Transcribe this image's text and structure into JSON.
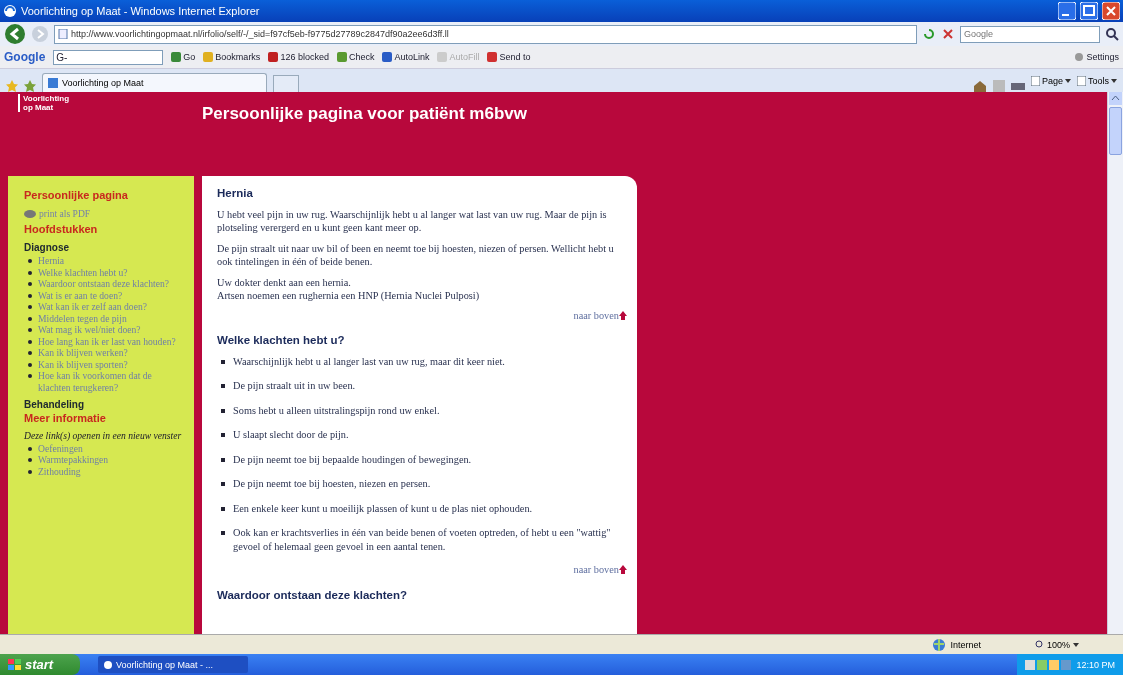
{
  "window": {
    "title": "Voorlichting op Maat - Windows Internet Explorer"
  },
  "address_bar": {
    "url": "http://www.voorlichtingopmaat.nl/irfolio/self/-/_sid=f97cf5eb-f9775d27789c2847df90a2ee6d3ff.ll",
    "search_placeholder": "Google"
  },
  "google_toolbar": {
    "logo": "Google",
    "search_label": "G-",
    "items": [
      {
        "kind": "go",
        "label": "Go"
      },
      {
        "kind": "bookmarks",
        "label": "Bookmarks"
      },
      {
        "kind": "blocked",
        "label": "126 blocked"
      },
      {
        "kind": "check",
        "label": "Check"
      },
      {
        "kind": "autolink",
        "label": "AutoLink"
      },
      {
        "kind": "autofill",
        "label": "AutoFill",
        "disabled": true
      },
      {
        "kind": "sendto",
        "label": "Send to"
      }
    ],
    "settings": "Settings"
  },
  "tab": {
    "label": "Voorlichting op Maat"
  },
  "command_bar": {
    "items": [
      "Page",
      "Tools"
    ]
  },
  "page": {
    "logo": "Voorlichting op Maat",
    "heading": "Persoonlijke pagina voor patiënt m6bvw",
    "sidebar": [
      {
        "kind": "heading",
        "text": "Persoonlijke pagina"
      },
      {
        "kind": "pdf",
        "text": "print als PDF"
      },
      {
        "kind": "heading",
        "text": "Hoofdstukken"
      },
      {
        "kind": "subheading",
        "text": "Diagnose"
      },
      {
        "kind": "links",
        "items": [
          "Hernia",
          "Welke klachten hebt u?",
          "Waardoor ontstaan deze klachten?",
          "Wat is er aan te doen?",
          "Wat kan ik er zelf aan doen?",
          "Middelen tegen de pijn",
          "Wat mag ik wel/niet doen?",
          "Hoe lang kan ik er last van houden?",
          "Kan ik blijven werken?",
          "Kan ik blijven sporten?",
          "Hoe kan ik voorkomen dat de klachten terugkeren?"
        ]
      },
      {
        "kind": "subheading",
        "text": "Behandeling"
      },
      {
        "kind": "heading",
        "text": "Meer informatie"
      },
      {
        "kind": "note",
        "text": "Deze link(s) openen in een nieuw venster"
      },
      {
        "kind": "links",
        "items": [
          "Oefeningen",
          "Warmtepakkingen",
          "Zithouding"
        ]
      }
    ],
    "sections": [
      {
        "title": "Hernia",
        "paragraphs": [
          "U hebt veel pijn in uw rug. Waarschijnlijk hebt u al langer wat last van uw rug. Maar de pijn is plotseling verergerd en u kunt geen kant meer op.",
          "De pijn straalt uit naar uw bil of been en neemt toe bij hoesten, niezen of persen. Wellicht hebt u ook tintelingen in één of beide benen.",
          "Uw dokter denkt aan een hernia.\nArtsen noemen een rughernia een HNP (Hernia Nuclei Pulposi)"
        ],
        "back_link": "naar boven"
      },
      {
        "title": "Welke klachten hebt u?",
        "bullets": [
          "Waarschijnlijk hebt u al langer last van uw rug, maar dit keer niet.",
          "De pijn straalt uit in uw been.",
          "Soms hebt u alleen uitstralingspijn rond uw enkel.",
          "U slaapt slecht door de pijn.",
          "De pijn neemt toe bij bepaalde houdingen of bewegingen.",
          "De pijn neemt toe bij hoesten, niezen en persen.",
          "Een enkele keer kunt u moeilijk plassen of kunt u de plas niet ophouden.",
          "Ook kan er krachtsverlies in één van beide benen of voeten optreden, of hebt u een \"wattig\" gevoel of helemaal geen gevoel in een aantal tenen."
        ],
        "back_link": "naar boven"
      },
      {
        "title": "Waardoor ontstaan deze klachten?"
      }
    ]
  },
  "status_bar": {
    "zone": "Internet",
    "zoom": "100%"
  },
  "taskbar": {
    "start": "start",
    "tasks": [
      {
        "label": "Voorlichting op Maat - ...",
        "selected": true
      }
    ],
    "clock": "12:10 PM"
  }
}
